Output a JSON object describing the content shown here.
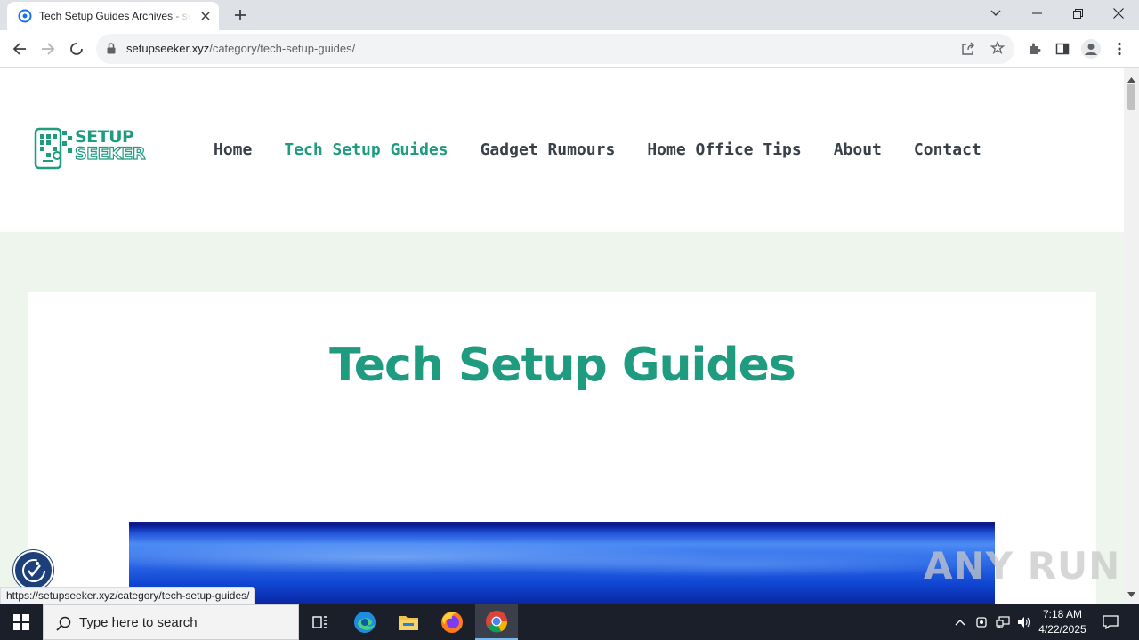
{
  "browser": {
    "tab_title": "Tech Setup Guides Archives - setupseeker",
    "url_host": "setupseeker.xyz",
    "url_path": "/category/tech-setup-guides/",
    "status_url": "https://setupseeker.xyz/category/tech-setup-guides/"
  },
  "site": {
    "logo_line1": "SETUP",
    "logo_line2": "SEEKER",
    "nav": [
      {
        "label": "Home",
        "active": false
      },
      {
        "label": "Tech Setup Guides",
        "active": true
      },
      {
        "label": "Gadget Rumours",
        "active": false
      },
      {
        "label": "Home Office Tips",
        "active": false
      },
      {
        "label": "About",
        "active": false
      },
      {
        "label": "Contact",
        "active": false
      }
    ],
    "heading": "Tech Setup Guides",
    "brand_color": "#1f9b80"
  },
  "watermark": "ANY RUN",
  "taskbar": {
    "search_placeholder": "Type here to search",
    "time": "7:18 AM",
    "date": "4/22/2025"
  }
}
